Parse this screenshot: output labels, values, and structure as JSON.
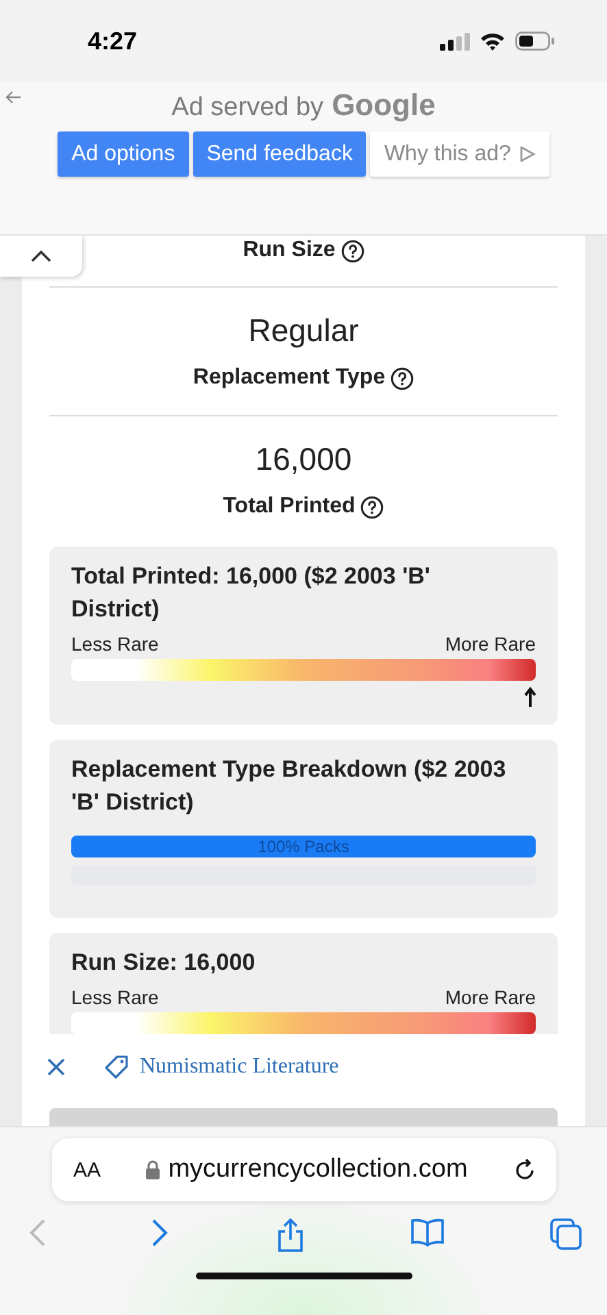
{
  "status_bar": {
    "time": "4:27"
  },
  "ad": {
    "attribution": "Ad served by",
    "brand": "Google",
    "buttons": [
      {
        "label": "Ad options",
        "kind": "primary"
      },
      {
        "label": "Send feedback",
        "kind": "primary"
      },
      {
        "label": "Why this ad?",
        "kind": "secondary"
      }
    ]
  },
  "stats": [
    {
      "label": "Run Size"
    },
    {
      "value": "Regular",
      "label": "Replacement Type"
    },
    {
      "value": "16,000",
      "label": "Total Printed"
    }
  ],
  "panels": [
    {
      "kind": "rarity",
      "title": "Total Printed: 16,000 ($2 2003 'B' District)",
      "low_label": "Less Rare",
      "high_label": "More Rare",
      "level": 1
    },
    {
      "kind": "breakdown",
      "title": "Replacement Type Breakdown ($2 2003 'B' District)",
      "segments": [
        {
          "label": "100% Packs"
        }
      ]
    },
    {
      "kind": "rarity",
      "title": "Run Size: 16,000",
      "low_label": "Less Rare",
      "high_label": "More Rare"
    }
  ],
  "tag_bar": {
    "label": "Numismatic Literature"
  },
  "browser": {
    "text_size": "AA",
    "url": "mycurrencycollection.com",
    "back_enabled": false,
    "forward_enabled": true
  }
}
